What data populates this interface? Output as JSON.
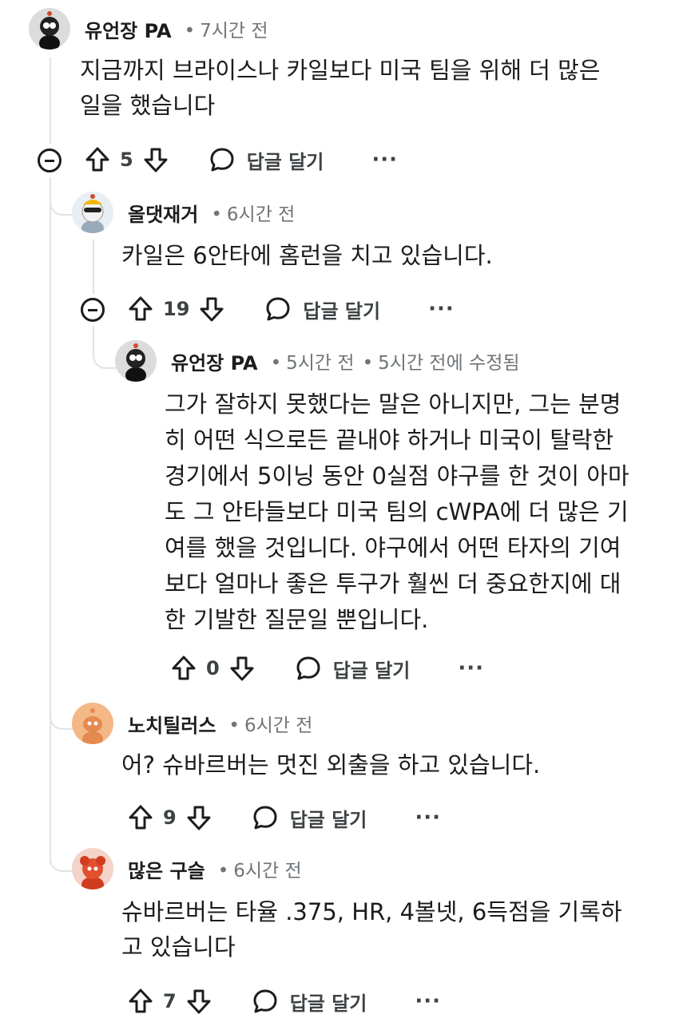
{
  "comments": [
    {
      "author": "유언장 PA",
      "time": "7시간 전",
      "body": "지금까지 브라이스나 카일보다 미국 팀을 위해 더 많은\n일을 했습니다",
      "votes": "5",
      "reply_label": "답글 달기",
      "more_label": "···"
    },
    {
      "author": "올댓재거",
      "time": "6시간 전",
      "body": "카일은 6안타에 홈런을 치고 있습니다.",
      "votes": "19",
      "reply_label": "답글 달기",
      "more_label": "···"
    },
    {
      "author": "유언장 PA",
      "time": "5시간 전",
      "edited": "5시간 전에 수정됨",
      "body": "그가 잘하지 못했다는 말은 아니지만, 그는 분명\n히 어떤 식으로든 끝내야 하거나 미국이 탈락한\n경기에서 5이닝 동안 0실점 야구를 한 것이 아마\n도 그 안타들보다 미국 팀의 cWPA에 더 많은 기\n여를 했을 것입니다. 야구에서 어떤 타자의 기여\n보다 얼마나 좋은 투구가 훨씬 더 중요한지에 대\n한 기발한 질문일 뿐입니다.",
      "votes": "0",
      "reply_label": "답글 달기",
      "more_label": "···"
    },
    {
      "author": "노치틸러스",
      "time": "6시간 전",
      "body": "어? 슈바르버는 멋진 외출을 하고 있습니다.",
      "votes": "9",
      "reply_label": "답글 달기",
      "more_label": "···"
    },
    {
      "author": "많은 구슬",
      "time": "6시간 전",
      "body": "슈바르버는 타율 .375, HR, 4볼넷, 6득점을 기록하\n고 있습니다",
      "votes": "7",
      "reply_label": "답글 달기",
      "more_label": "···"
    }
  ],
  "meta_separator": "•",
  "colors": {
    "text": "#1c1c1c",
    "muted": "#6f7478",
    "thread": "#e3e3e3"
  }
}
